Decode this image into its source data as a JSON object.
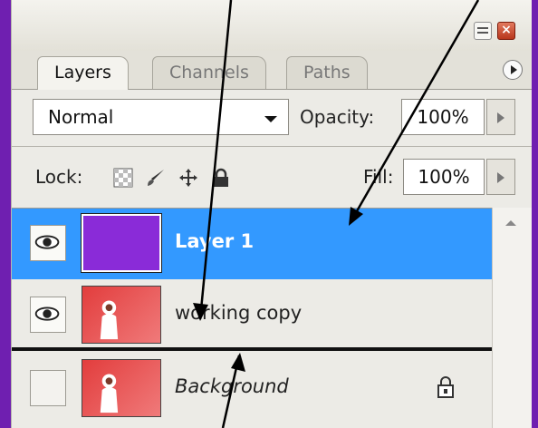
{
  "tabs": [
    {
      "label": "Layers"
    },
    {
      "label": "Channels"
    },
    {
      "label": "Paths"
    }
  ],
  "blend_mode": {
    "value": "Normal"
  },
  "opacity": {
    "label": "Opacity:",
    "value": "100%"
  },
  "lock": {
    "label": "Lock:",
    "icons": [
      "transparency-lock-icon",
      "brush-lock-icon",
      "move-lock-icon",
      "padlock-icon"
    ]
  },
  "fill": {
    "label": "Fill:",
    "value": "100%"
  },
  "layers": [
    {
      "name": "Layer 1",
      "visible": true,
      "selected": true,
      "thumb": "purple",
      "thumb_color": "#8a2bd8"
    },
    {
      "name": "working copy",
      "visible": true,
      "selected": false,
      "thumb": "photo"
    },
    {
      "name": "Background",
      "visible": false,
      "selected": false,
      "thumb": "photo",
      "locked": true
    }
  ],
  "colors": {
    "selection": "#3399ff",
    "frame": "#6f1fb0",
    "layer1_fill": "#8a2bd8"
  }
}
